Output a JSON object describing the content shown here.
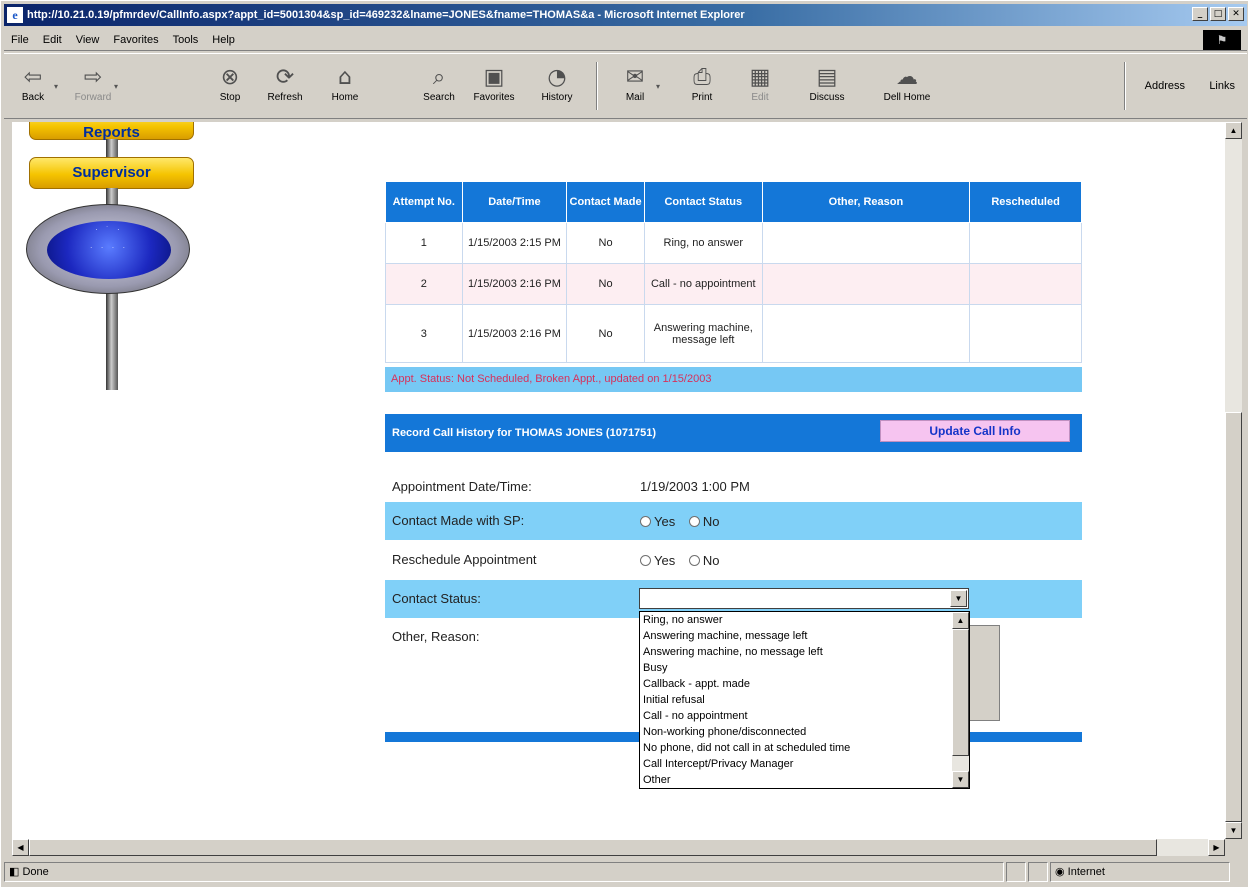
{
  "window": {
    "title": "http://10.21.0.19/pfmrdev/CallInfo.aspx?appt_id=5001304&sp_id=469232&lname=JONES&fname=THOMAS&a - Microsoft Internet Explorer",
    "controls": [
      "_",
      "□",
      "✕"
    ]
  },
  "menu": [
    "File",
    "Edit",
    "View",
    "Favorites",
    "Tools",
    "Help"
  ],
  "toolbar": {
    "back": "Back",
    "forward": "Forward",
    "stop": "Stop",
    "refresh": "Refresh",
    "home": "Home",
    "search": "Search",
    "favorites": "Favorites",
    "history": "History",
    "mail": "Mail",
    "print": "Print",
    "edit": "Edit",
    "discuss": "Discuss",
    "dellhome": "Dell Home",
    "address": "Address",
    "links": "Links"
  },
  "sidebar": {
    "reports": "Reports",
    "supervisor": "Supervisor"
  },
  "attempts": {
    "headers": [
      "Attempt No.",
      "Date/Time",
      "Contact Made",
      "Contact Status",
      "Other, Reason",
      "Rescheduled"
    ],
    "rows": [
      [
        "1",
        "1/15/2003 2:15 PM",
        "No",
        "Ring, no answer",
        "",
        ""
      ],
      [
        "2",
        "1/15/2003 2:16 PM",
        "No",
        "Call - no appointment",
        "",
        ""
      ],
      [
        "3",
        "1/15/2003 2:16 PM",
        "No",
        "Answering machine, message left",
        "",
        ""
      ]
    ],
    "status": "Appt. Status: Not Scheduled, Broken Appt., updated on 1/15/2003"
  },
  "record": {
    "header": "Record Call History for THOMAS JONES (1071751)",
    "update_button": "Update Call Info",
    "appt_label": "Appointment Date/Time:",
    "appt_value": "1/19/2003 1:00 PM",
    "contact_made_label": "Contact Made with SP:",
    "reschedule_label": "Reschedule Appointment",
    "yes": "Yes",
    "no": "No",
    "contact_status_label": "Contact Status:",
    "contact_status_value": "",
    "other_reason_label": "Other, Reason:",
    "options": [
      "Ring, no answer",
      "Answering machine, message left",
      "Answering machine, no message left",
      "Busy",
      "Callback - appt. made",
      "Initial refusal",
      "Call - no appointment",
      "Non-working phone/disconnected",
      "No phone, did not call in at scheduled time",
      "Call Intercept/Privacy Manager",
      "Other"
    ]
  },
  "status": {
    "text": "Done",
    "zone": "Internet"
  },
  "colors": {
    "header_blue": "#1477d8",
    "light_blue": "#80d0f8",
    "button_pink": "#f6c4f0"
  }
}
